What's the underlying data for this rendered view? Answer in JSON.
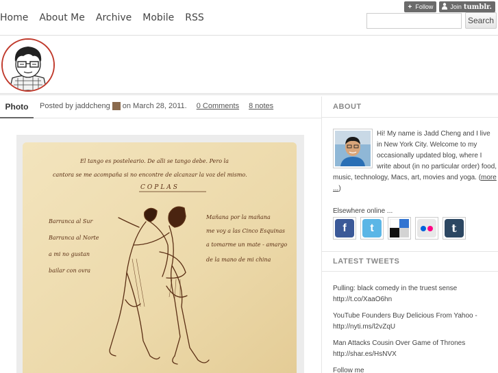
{
  "nav": {
    "links": [
      "Home",
      "About Me",
      "Archive",
      "Mobile",
      "RSS"
    ],
    "follow_label": "Follow",
    "join_prefix": "Join",
    "join_brand": "tumblr.",
    "search_placeholder": "",
    "search_button": "Search"
  },
  "post": {
    "type_label": "Photo",
    "posted_by": "Posted by jaddcheng",
    "date": "on March 28, 2011.",
    "comments": "0 Comments",
    "notes": "8 notes"
  },
  "photo_text": {
    "line1": "El tango es posteleario. De alli se tango debe. Pero la",
    "line2": "cantora se me acompaña si no encontre de alcanzar la voz del mismo.",
    "title": "COPLAS",
    "left1": "Barranca al Sur",
    "left2": "Barranca al Norte",
    "left3": "a mi no gustan",
    "left4": "bailar con ovra",
    "right1": "Mañana por la mañana",
    "right2": "me voy a las Cinco Esquinas",
    "right3": "a tomarme un mate - amargo",
    "right4": "de la mano de mi china"
  },
  "sidebar": {
    "about_title": "ABOUT",
    "about_text": "Hi! My name is Jadd Cheng and I live in New York City. Welcome to my occasionally updated blog, where I write about (in no particular order) food, music, technology, Macs, art, movies and yoga.",
    "more_link": "more ...",
    "elsewhere": "Elsewhere online ...",
    "social": [
      {
        "name": "facebook",
        "glyph": "f",
        "color": "#3b5998"
      },
      {
        "name": "twitter",
        "glyph": "t",
        "color": "#5bb6e6"
      },
      {
        "name": "delicious",
        "glyph": "",
        "color": "#ffffff"
      },
      {
        "name": "flickr",
        "glyph": "••",
        "color": "#e8e8e8"
      },
      {
        "name": "tumblr",
        "glyph": "t",
        "color": "#2c4762"
      }
    ],
    "tweets_title": "LATEST TWEETS",
    "tweets": [
      {
        "text": "Pulling: black comedy in the truest sense",
        "link": "http://t.co/XaaO6hn"
      },
      {
        "text": "YouTube Founders Buy Delicious From Yahoo -",
        "link": "http://nyti.ms/l2vZqU"
      },
      {
        "text": "Man Attacks Cousin Over Game of Thrones",
        "link": "http://shar.es/HsNVX"
      }
    ],
    "follow_me": "Follow me"
  }
}
